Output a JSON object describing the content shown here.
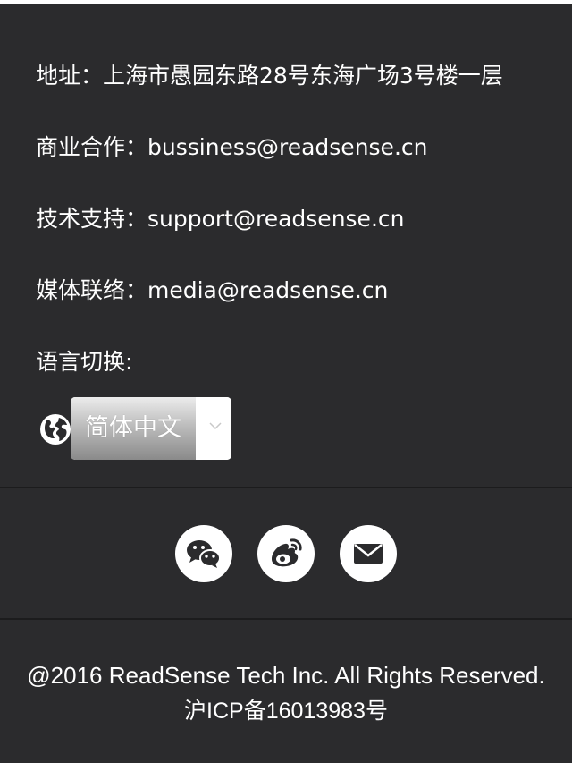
{
  "contact": {
    "address": "地址：上海市愚园东路28号东海广场3号楼一层",
    "business": "商业合作：bussiness@readsense.cn",
    "support": "技术支持：support@readsense.cn",
    "media": "媒体联络：media@readsense.cn"
  },
  "language": {
    "label": "语言切换:",
    "selected": "简体中文",
    "icon": "globe-icon"
  },
  "social": {
    "icons": [
      "wechat-icon",
      "weibo-icon",
      "mail-icon"
    ]
  },
  "footer": {
    "copyright": "@2016 ReadSense Tech Inc. All Rights Reserved.",
    "icp": "沪ICP备16013983号"
  },
  "colors": {
    "background": "#2b2b2d",
    "text": "#ffffff",
    "divider": "#1c1c1d"
  }
}
